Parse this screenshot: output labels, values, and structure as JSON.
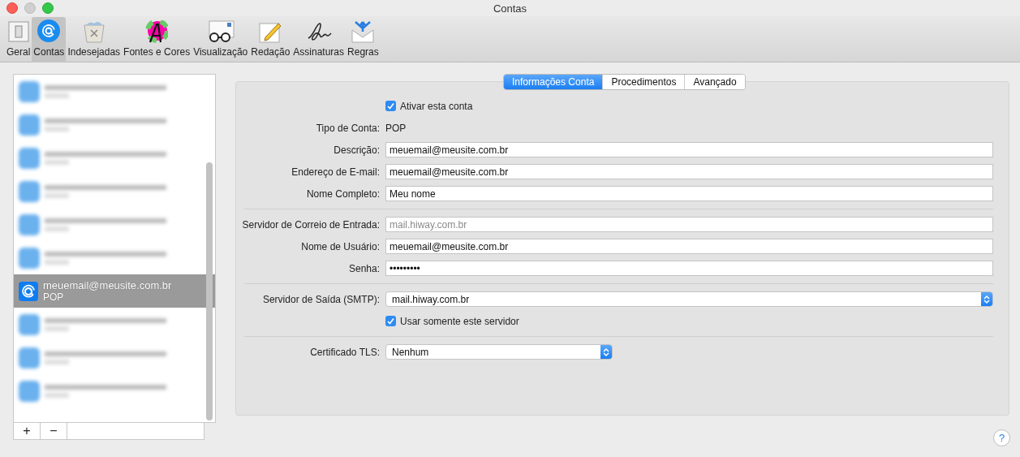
{
  "window": {
    "title": "Contas"
  },
  "toolbar": [
    {
      "label": "Geral",
      "selected": false
    },
    {
      "label": "Contas",
      "selected": true
    },
    {
      "label": "Indesejadas",
      "selected": false
    },
    {
      "label": "Fontes e Cores",
      "selected": false
    },
    {
      "label": "Visualização",
      "selected": false
    },
    {
      "label": "Redação",
      "selected": false
    },
    {
      "label": "Assinaturas",
      "selected": false
    },
    {
      "label": "Regras",
      "selected": false
    }
  ],
  "accounts": [
    {
      "kind": "blurred",
      "selected": false
    },
    {
      "kind": "blurred",
      "selected": false
    },
    {
      "kind": "blurred",
      "selected": false
    },
    {
      "kind": "blurred",
      "selected": false
    },
    {
      "kind": "blurred",
      "selected": false
    },
    {
      "kind": "blurred",
      "selected": false
    },
    {
      "kind": "account",
      "name": "meuemail@meusite.com.br",
      "type": "POP",
      "selected": true
    },
    {
      "kind": "blurred",
      "selected": false
    },
    {
      "kind": "blurred",
      "selected": false
    },
    {
      "kind": "blurred",
      "selected": false
    }
  ],
  "list_buttons": [
    "+",
    "−"
  ],
  "tabs": [
    {
      "label": "Informações Conta",
      "selected": true
    },
    {
      "label": "Procedimentos",
      "selected": false
    },
    {
      "label": "Avançado",
      "selected": false
    }
  ],
  "form": [
    {
      "kind": "checkbox",
      "label": "Ativar esta conta",
      "checked": true
    },
    {
      "kind": "static",
      "label": "Tipo de Conta:",
      "value": "POP"
    },
    {
      "kind": "field",
      "label": "Descrição:",
      "value": "meuemail@meusite.com.br",
      "disabled": false
    },
    {
      "kind": "field",
      "label": "Endereço de E-mail:",
      "value": "meuemail@meusite.com.br",
      "disabled": false
    },
    {
      "kind": "field",
      "label": "Nome Completo:",
      "value": "Meu nome",
      "disabled": false
    },
    {
      "kind": "separator"
    },
    {
      "kind": "field",
      "label": "Servidor de Correio de Entrada:",
      "value": "mail.hiway.com.br",
      "disabled": true
    },
    {
      "kind": "field",
      "label": "Nome de Usuário:",
      "value": "meuemail@meusite.com.br",
      "disabled": false
    },
    {
      "kind": "field",
      "label": "Senha:",
      "value": "•••••••••",
      "disabled": false
    },
    {
      "kind": "separator"
    },
    {
      "kind": "combo",
      "label": "Servidor de Saída (SMTP):",
      "value": "mail.hiway.com.br"
    },
    {
      "kind": "checkbox",
      "label": "Usar somente este servidor",
      "checked": true
    },
    {
      "kind": "separator"
    },
    {
      "kind": "popup",
      "label": "Certificado TLS:",
      "value": "Nenhum"
    }
  ],
  "help_button": "?"
}
